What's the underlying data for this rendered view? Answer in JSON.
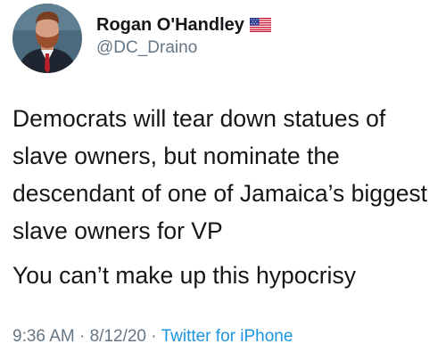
{
  "tweet": {
    "user": {
      "display_name": "Rogan O'Handley",
      "handle": "@DC_Draino",
      "flag_icon": "us-flag-icon",
      "avatar_icon": "profile-photo-avatar"
    },
    "text": {
      "paragraph_1": "Democrats will tear down statues of slave owners, but nominate the descendant of one of Jamaica’s biggest slave owners for VP",
      "paragraph_2": "You can’t make up this hypocrisy"
    },
    "meta": {
      "time": "9:36 AM",
      "separator": " · ",
      "date": "8/12/20",
      "source": "Twitter for iPhone"
    },
    "colors": {
      "text": "#14171a",
      "secondary": "#657786",
      "link": "#1b95e0"
    }
  }
}
